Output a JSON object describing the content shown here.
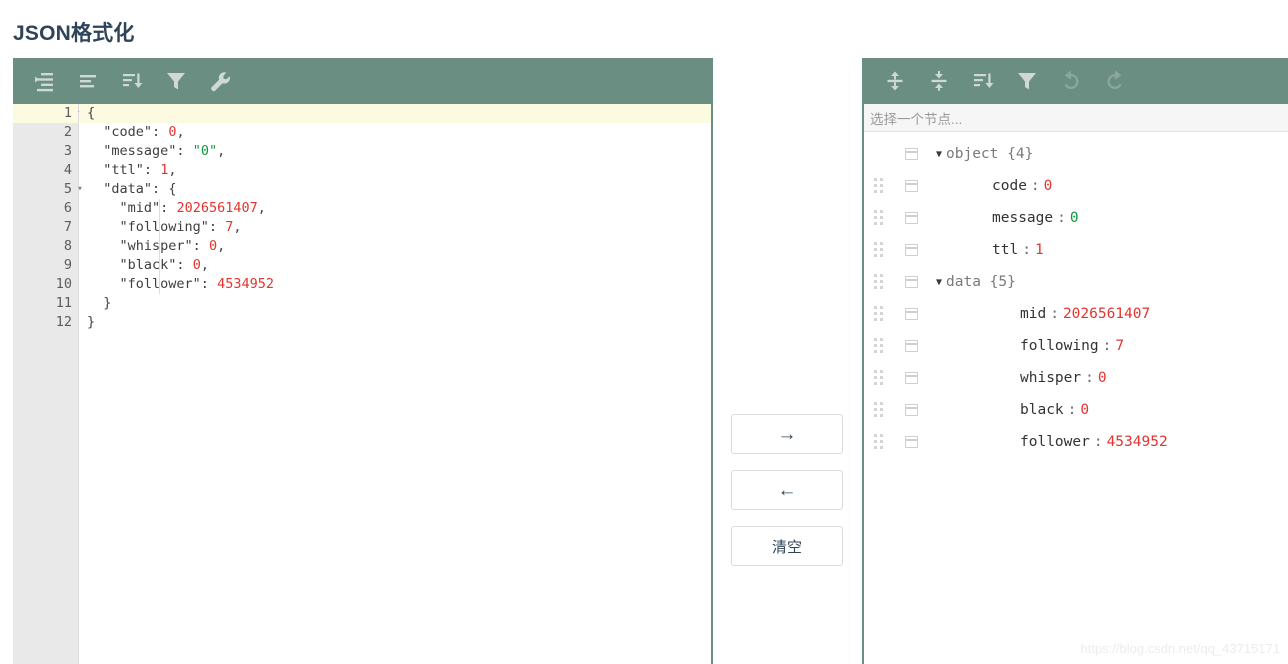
{
  "page": {
    "title": "JSON格式化",
    "watermark": "https://blog.csdn.net/qq_43715171"
  },
  "colors": {
    "toolbar_green": "#6b8e82",
    "title_navy": "#2e4458",
    "number_red": "#e3342f",
    "string_green": "#0b9b3b",
    "active_line_yellow": "#fcfae0",
    "gutter_gray": "#e9e9e9"
  },
  "editor": {
    "toolbar": [
      {
        "name": "format-icon",
        "title": "格式化"
      },
      {
        "name": "compact-icon",
        "title": "压缩"
      },
      {
        "name": "sort-icon",
        "title": "排序"
      },
      {
        "name": "filter-icon",
        "title": "过滤"
      },
      {
        "name": "repair-icon",
        "title": "修复"
      }
    ],
    "lines": [
      {
        "no": "1",
        "foldable": true,
        "active": true,
        "text": "{"
      },
      {
        "no": "2",
        "foldable": false,
        "active": false,
        "text": "  \"code\": 0,"
      },
      {
        "no": "3",
        "foldable": false,
        "active": false,
        "text": "  \"message\": \"0\","
      },
      {
        "no": "4",
        "foldable": false,
        "active": false,
        "text": "  \"ttl\": 1,"
      },
      {
        "no": "5",
        "foldable": true,
        "active": false,
        "text": "  \"data\": {"
      },
      {
        "no": "6",
        "foldable": false,
        "active": false,
        "text": "    \"mid\": 2026561407,"
      },
      {
        "no": "7",
        "foldable": false,
        "active": false,
        "text": "    \"following\": 7,"
      },
      {
        "no": "8",
        "foldable": false,
        "active": false,
        "text": "    \"whisper\": 0,"
      },
      {
        "no": "9",
        "foldable": false,
        "active": false,
        "text": "    \"black\": 0,"
      },
      {
        "no": "10",
        "foldable": false,
        "active": false,
        "text": "    \"follower\": 4534952"
      },
      {
        "no": "11",
        "foldable": false,
        "active": false,
        "text": "  }"
      },
      {
        "no": "12",
        "foldable": false,
        "active": false,
        "text": "}"
      }
    ]
  },
  "transfer": {
    "to_tree_label": "→",
    "to_text_label": "←",
    "clear_label": "清空"
  },
  "tree_panel": {
    "toolbar": [
      {
        "name": "expand-all-icon",
        "title": "展开全部"
      },
      {
        "name": "collapse-all-icon",
        "title": "收起全部"
      },
      {
        "name": "sort-icon",
        "title": "排序"
      },
      {
        "name": "filter-icon",
        "title": "过滤"
      },
      {
        "name": "undo-icon",
        "title": "撤销"
      },
      {
        "name": "redo-icon",
        "title": "重做"
      }
    ],
    "path_placeholder": "选择一个节点...",
    "rows": [
      {
        "drag": false,
        "caret": "▼",
        "indent": 1,
        "key": "object",
        "count": "{4}",
        "colon": "",
        "value": "",
        "value_type": "node"
      },
      {
        "drag": true,
        "caret": "",
        "indent": 2,
        "key": "code",
        "count": "",
        "colon": ":",
        "value": "0",
        "value_type": "num"
      },
      {
        "drag": true,
        "caret": "",
        "indent": 2,
        "key": "message",
        "count": "",
        "colon": ":",
        "value": "0",
        "value_type": "str"
      },
      {
        "drag": true,
        "caret": "",
        "indent": 2,
        "key": "ttl",
        "count": "",
        "colon": ":",
        "value": "1",
        "value_type": "num"
      },
      {
        "drag": true,
        "caret": "▼",
        "indent": 1,
        "key": "data",
        "count": "{5}",
        "colon": "",
        "value": "",
        "value_type": "node"
      },
      {
        "drag": true,
        "caret": "",
        "indent": 3,
        "key": "mid",
        "count": "",
        "colon": ":",
        "value": "2026561407",
        "value_type": "num"
      },
      {
        "drag": true,
        "caret": "",
        "indent": 3,
        "key": "following",
        "count": "",
        "colon": ":",
        "value": "7",
        "value_type": "num"
      },
      {
        "drag": true,
        "caret": "",
        "indent": 3,
        "key": "whisper",
        "count": "",
        "colon": ":",
        "value": "0",
        "value_type": "num"
      },
      {
        "drag": true,
        "caret": "",
        "indent": 3,
        "key": "black",
        "count": "",
        "colon": ":",
        "value": "0",
        "value_type": "num"
      },
      {
        "drag": true,
        "caret": "",
        "indent": 3,
        "key": "follower",
        "count": "",
        "colon": ":",
        "value": "4534952",
        "value_type": "num"
      }
    ]
  }
}
